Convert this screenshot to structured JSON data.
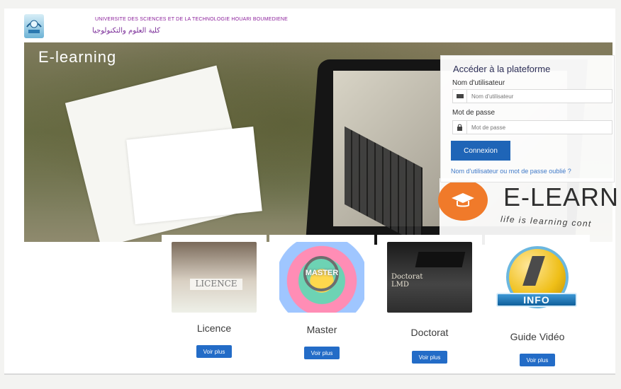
{
  "header": {
    "university_name": "UNIVERSITE DES SCIENCES ET DE LA TECHNOLOGIE HOUARI BOUMEDIENE",
    "university_name_ar": "كلية العلوم والتكنولوجيا",
    "hero_title": "E-learning"
  },
  "login": {
    "title": "Accéder à la plateforme",
    "username_label": "Nom d'utilisateur",
    "username_placeholder": "Nom d'utilisateur",
    "password_label": "Mot de passe",
    "password_placeholder": "Mot de passe",
    "submit_label": "Connexion",
    "forgot_link": "Nom d'utilisateur ou mot de passe oublié ?"
  },
  "branding": {
    "word": "E-LEARN",
    "tagline": "life is learning cont"
  },
  "cards": [
    {
      "label": "Licence",
      "button": "Voir plus",
      "image_text": "LICENCE"
    },
    {
      "label": "Master",
      "button": "Voir plus",
      "image_text": "MASTER"
    },
    {
      "label": "Doctorat",
      "button": "Voir plus",
      "image_text": "Doctorat LMD"
    },
    {
      "label": "Guide Vidéo",
      "button": "Voir plus",
      "image_text": "INFO"
    }
  ],
  "colors": {
    "primary_button": "#1f65b7",
    "link": "#3f79c8",
    "university_text": "#8b1f9b",
    "brand_accent": "#f07a2a"
  }
}
